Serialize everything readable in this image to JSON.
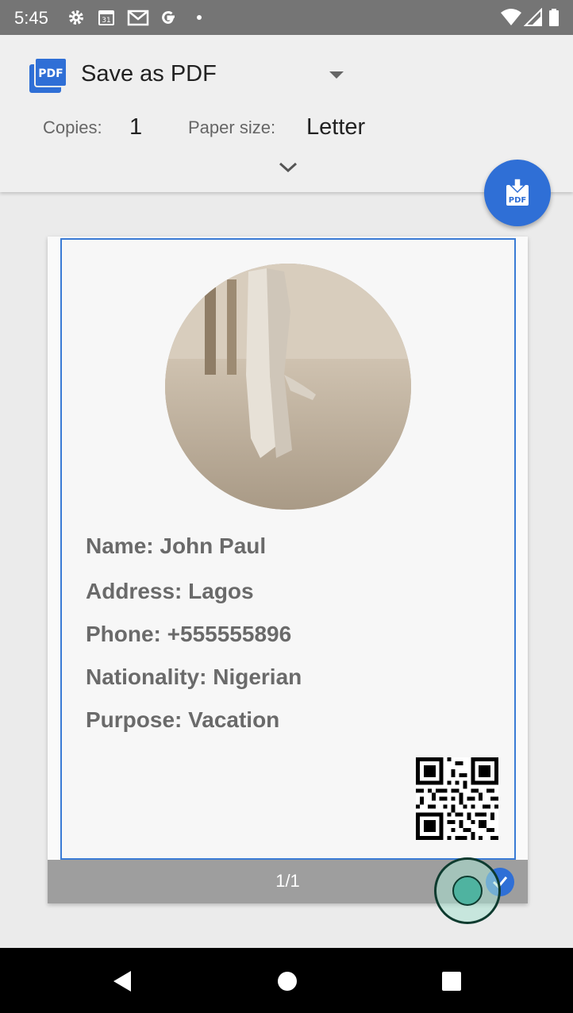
{
  "status_bar": {
    "time": "5:45",
    "icons": [
      "settings-icon",
      "calendar-icon",
      "gmail-icon",
      "google-icon",
      "dot-icon",
      "wifi-icon",
      "signal-icon",
      "battery-icon"
    ]
  },
  "print_header": {
    "destination": "Save as PDF",
    "copies_label": "Copies:",
    "copies_value": "1",
    "paper_label": "Paper size:",
    "paper_value": "Letter"
  },
  "preview": {
    "fields": [
      "Name: John Paul",
      "Address: Lagos",
      "Phone: +555555896",
      "Nationality: Nigerian",
      "Purpose: Vacation"
    ],
    "page_number": "1/1"
  },
  "colors": {
    "accent": "#2f6fd6",
    "status_bar": "#757575",
    "field_text": "#6a6a6a"
  }
}
